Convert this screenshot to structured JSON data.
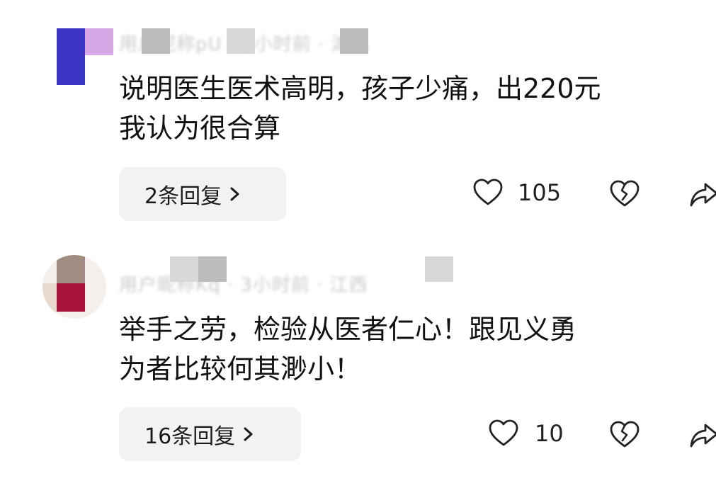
{
  "comments": [
    {
      "meta_obscured": "用户昵称pU · 3小时前 · 湖北",
      "text_lines": [
        "说明医生医术高明，孩子少痛，出220元",
        "我认为很合算"
      ],
      "reply_label": "2条回复",
      "like_count": "105",
      "avatar_colors": [
        "#3b35c4",
        "#d7a7e6"
      ]
    },
    {
      "meta_obscured": "用户昵称Kq · 3小时前 · 江西",
      "text_lines": [
        "举手之劳，检验从医者仁心！跟见义勇",
        "为者比较何其渺小！"
      ],
      "reply_label": "16条回复",
      "like_count": "10",
      "avatar_colors": [
        "#a08c80",
        "#a8143c"
      ]
    }
  ],
  "icons": {
    "like": "heart-outline-icon",
    "dislike": "broken-heart-icon",
    "share": "share-arrow-icon",
    "reply_chevron": "chevron-right-icon"
  }
}
